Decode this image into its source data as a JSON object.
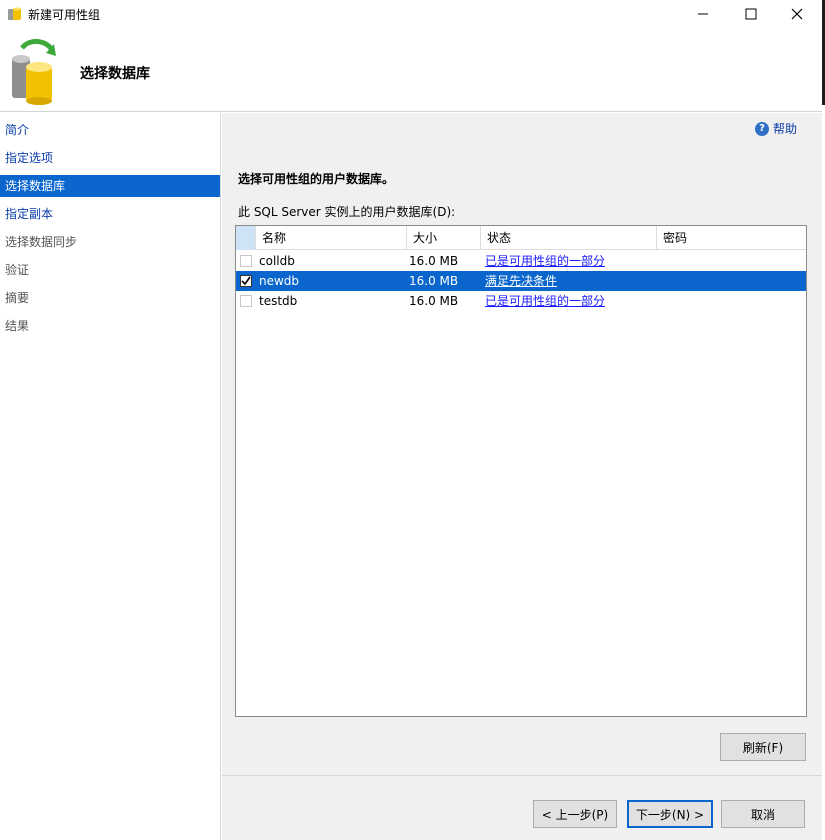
{
  "window": {
    "title": "新建可用性组"
  },
  "header": {
    "title": "选择数据库"
  },
  "nav": {
    "items": [
      {
        "label": "简介",
        "state": "link"
      },
      {
        "label": "指定选项",
        "state": "link"
      },
      {
        "label": "选择数据库",
        "state": "active"
      },
      {
        "label": "指定副本",
        "state": "link"
      },
      {
        "label": "选择数据同步",
        "state": "disabled"
      },
      {
        "label": "验证",
        "state": "disabled"
      },
      {
        "label": "摘要",
        "state": "disabled"
      },
      {
        "label": "结果",
        "state": "disabled"
      }
    ]
  },
  "content": {
    "help_label": "帮助",
    "instruction": "选择可用性组的用户数据库。",
    "list_label": "此 SQL Server 实例上的用户数据库(D):",
    "grid": {
      "columns": [
        "名称",
        "大小",
        "状态",
        "密码"
      ],
      "rows": [
        {
          "checked": false,
          "name": "colldb",
          "size": "16.0 MB",
          "status": "已是可用性组的一部分",
          "password": ""
        },
        {
          "checked": true,
          "name": "newdb",
          "size": "16.0 MB",
          "status": "满足先决条件",
          "password": ""
        },
        {
          "checked": false,
          "name": "testdb",
          "size": "16.0 MB",
          "status": "已是可用性组的一部分",
          "password": ""
        }
      ],
      "selected_row": 1
    },
    "refresh_label": "刷新(F)"
  },
  "footer": {
    "prev_label": "< 上一步(P)",
    "next_label": "下一步(N) >",
    "cancel_label": "取消"
  }
}
